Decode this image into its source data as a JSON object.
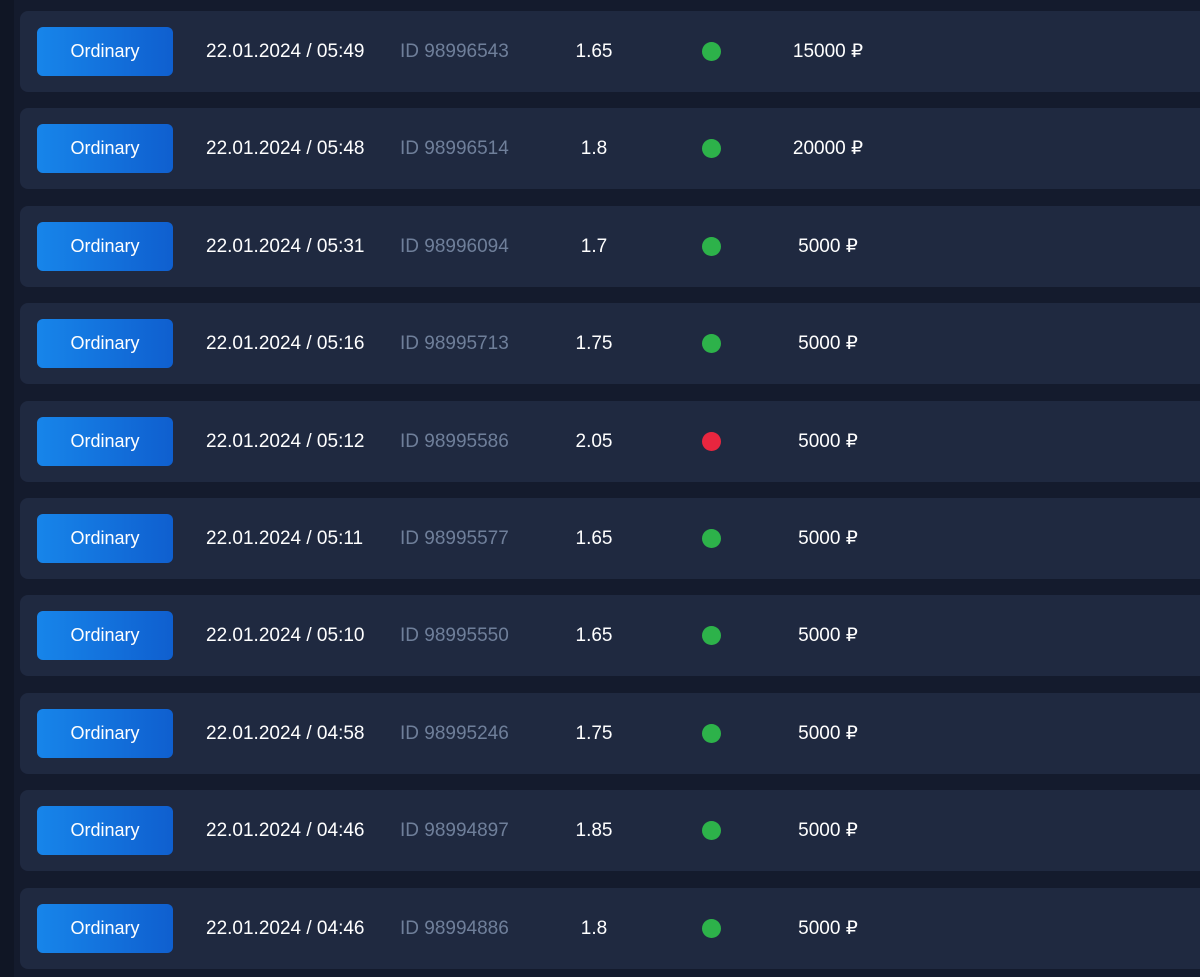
{
  "colors": {
    "win": "#2db24a",
    "loss": "#e8263f",
    "accent": "#1785ea"
  },
  "bets": [
    {
      "type": "Ordinary",
      "datetime": "22.01.2024 / 05:49",
      "id": "ID 98996543",
      "coef": "1.65",
      "status": "win",
      "amount": "15000 ₽"
    },
    {
      "type": "Ordinary",
      "datetime": "22.01.2024 / 05:48",
      "id": "ID 98996514",
      "coef": "1.8",
      "status": "win",
      "amount": "20000 ₽"
    },
    {
      "type": "Ordinary",
      "datetime": "22.01.2024 / 05:31",
      "id": "ID 98996094",
      "coef": "1.7",
      "status": "win",
      "amount": "5000 ₽"
    },
    {
      "type": "Ordinary",
      "datetime": "22.01.2024 / 05:16",
      "id": "ID 98995713",
      "coef": "1.75",
      "status": "win",
      "amount": "5000 ₽"
    },
    {
      "type": "Ordinary",
      "datetime": "22.01.2024 / 05:12",
      "id": "ID 98995586",
      "coef": "2.05",
      "status": "loss",
      "amount": "5000 ₽"
    },
    {
      "type": "Ordinary",
      "datetime": "22.01.2024 / 05:11",
      "id": "ID 98995577",
      "coef": "1.65",
      "status": "win",
      "amount": "5000 ₽"
    },
    {
      "type": "Ordinary",
      "datetime": "22.01.2024 / 05:10",
      "id": "ID 98995550",
      "coef": "1.65",
      "status": "win",
      "amount": "5000 ₽"
    },
    {
      "type": "Ordinary",
      "datetime": "22.01.2024 / 04:58",
      "id": "ID 98995246",
      "coef": "1.75",
      "status": "win",
      "amount": "5000 ₽"
    },
    {
      "type": "Ordinary",
      "datetime": "22.01.2024 / 04:46",
      "id": "ID 98994897",
      "coef": "1.85",
      "status": "win",
      "amount": "5000 ₽"
    },
    {
      "type": "Ordinary",
      "datetime": "22.01.2024 / 04:46",
      "id": "ID 98994886",
      "coef": "1.8",
      "status": "win",
      "amount": "5000 ₽"
    }
  ]
}
